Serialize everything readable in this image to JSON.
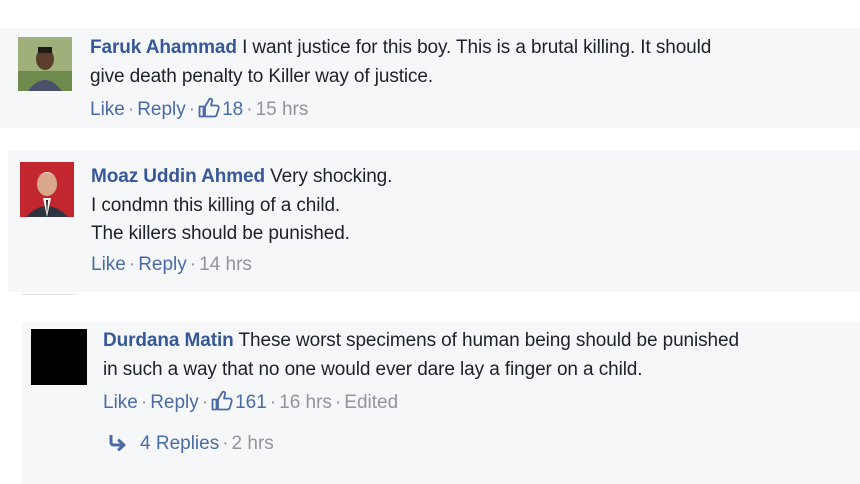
{
  "comments": [
    {
      "author": "Faruk Ahammad",
      "text_lines": [
        "I want justice for this boy. This is a brutal killing. It should",
        "give death penalty to Killer way of justice."
      ],
      "actions": {
        "like": "Like",
        "reply": "Reply",
        "sep": "·"
      },
      "like_count": "18",
      "time": "15 hrs",
      "edited": ""
    },
    {
      "author": "Moaz Uddin Ahmed",
      "text_lines": [
        "Very shocking.",
        "I condmn this killing of a child.",
        "The killers should be punished."
      ],
      "actions": {
        "like": "Like",
        "reply": "Reply",
        "sep": "·"
      },
      "like_count": "",
      "time": "14 hrs",
      "edited": ""
    },
    {
      "author": "Durdana Matin",
      "text_lines": [
        "These worst specimens of human being should be punished",
        "in such a way that no one would ever dare lay a finger on a child."
      ],
      "actions": {
        "like": "Like",
        "reply": "Reply",
        "sep": "·"
      },
      "like_count": "161",
      "time": "16 hrs",
      "edited": "Edited",
      "replies": {
        "label": "4 Replies",
        "time": "2 hrs"
      }
    }
  ],
  "colors": {
    "author": "#365899",
    "link": "#4b6aa8",
    "meta": "#90949c",
    "panel": "#f6f7f9"
  },
  "icons": {
    "like": "thumbs-up-icon",
    "reply_arrow": "reply-arrow-icon"
  }
}
